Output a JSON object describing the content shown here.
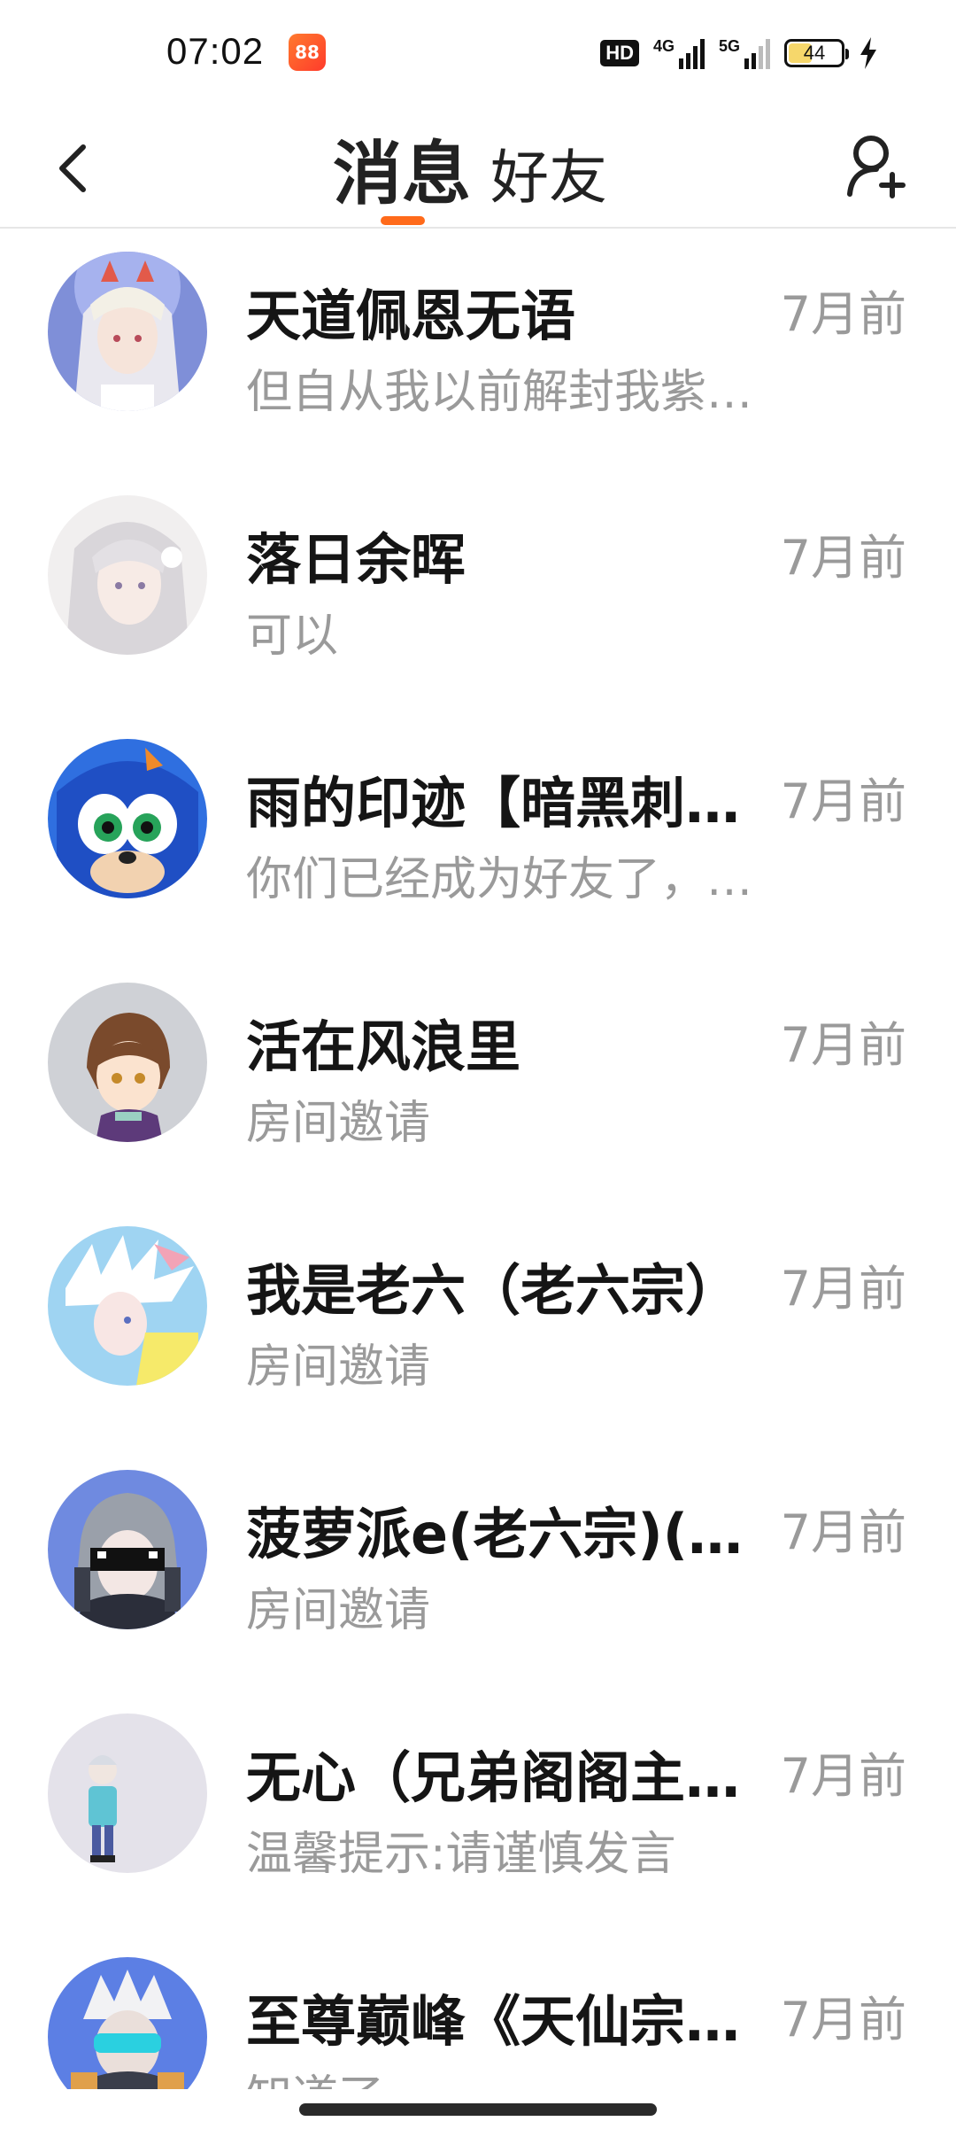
{
  "status_bar": {
    "time": "07:02",
    "app_icon_glyph": "88",
    "hd_label": "HD",
    "network_1": "4G",
    "network_2": "5G",
    "battery_level": "44",
    "battery_fraction": 0.44,
    "battery_fill_color": "#f6d76b"
  },
  "header": {
    "tabs": [
      {
        "label": "消息",
        "active": true
      },
      {
        "label": "好友",
        "active": false
      }
    ],
    "accent_color": "#ff6a1a",
    "back_icon": "chevron-left-icon",
    "add_icon": "add-friend-icon"
  },
  "conversations": [
    {
      "name": "天道佩恩无语",
      "preview": "但自从我以前解封我紫…",
      "time": "7月前",
      "avatar": "avatar-white-hair-crown"
    },
    {
      "name": "落日余晖",
      "preview": "可以",
      "time": "7月前",
      "avatar": "avatar-silver-hair-girl"
    },
    {
      "name": "雨的印迹【暗黑刺…",
      "preview": "你们已经成为好友了，…",
      "time": "7月前",
      "avatar": "avatar-blue-hedgehog"
    },
    {
      "name": "活在风浪里",
      "preview": "房间邀请",
      "time": "7月前",
      "avatar": "avatar-brown-hair-kid"
    },
    {
      "name": "我是老六（老六宗）",
      "preview": "房间邀请",
      "time": "7月前",
      "avatar": "avatar-white-spiky-hair"
    },
    {
      "name": "菠萝派e(老六宗)(…",
      "preview": "房间邀请",
      "time": "7月前",
      "avatar": "avatar-sunglasses-robot"
    },
    {
      "name": "无心（兄弟阁阁主…",
      "preview": "温馨提示:请谨慎发言",
      "time": "7月前",
      "avatar": "avatar-standing-character"
    },
    {
      "name": "至尊巅峰《天仙宗…",
      "preview": "知道了",
      "time": "7月前",
      "avatar": "avatar-visor-character"
    }
  ]
}
